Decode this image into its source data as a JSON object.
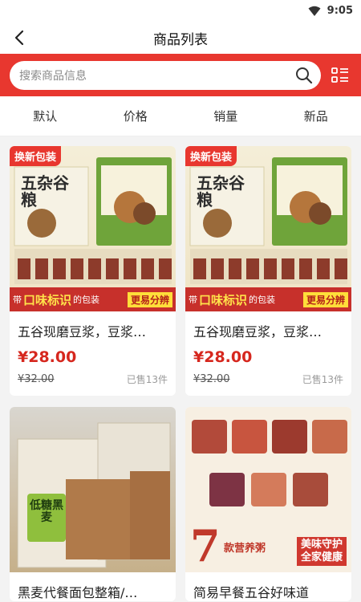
{
  "status": {
    "time": "9:05"
  },
  "header": {
    "title": "商品列表"
  },
  "search": {
    "placeholder": "搜索商品信息"
  },
  "sort_tabs": [
    "默认",
    "价格",
    "销量",
    "新品"
  ],
  "products": [
    {
      "name": "五谷现磨豆浆，豆浆…",
      "price": "¥28.00",
      "original_price": "¥32.00",
      "sold": "已售13件",
      "image": {
        "badge": "换新包装",
        "pack_text": "五杂谷粮",
        "strip_lead": "带",
        "strip_big": "口味标识",
        "strip_after": "的包装",
        "strip_tag": "更易分辨"
      }
    },
    {
      "name": "五谷现磨豆浆，豆浆…",
      "price": "¥28.00",
      "original_price": "¥32.00",
      "sold": "已售13件",
      "image": {
        "badge": "换新包装",
        "pack_text": "五杂谷粮",
        "strip_lead": "带",
        "strip_big": "口味标识",
        "strip_after": "的包装",
        "strip_tag": "更易分辨"
      }
    },
    {
      "name": "黑麦代餐面包整箱/…",
      "image": {
        "pack_text": "低糖黑麦"
      }
    },
    {
      "name": "简易早餐五谷好味道",
      "image": {
        "big_number": "7",
        "slogan": "款营养粥",
        "motto_1": "美味守护",
        "motto_2": "全家健康"
      }
    }
  ],
  "colors": {
    "brand_red": "#e8372f",
    "price_red": "#d6271e"
  }
}
